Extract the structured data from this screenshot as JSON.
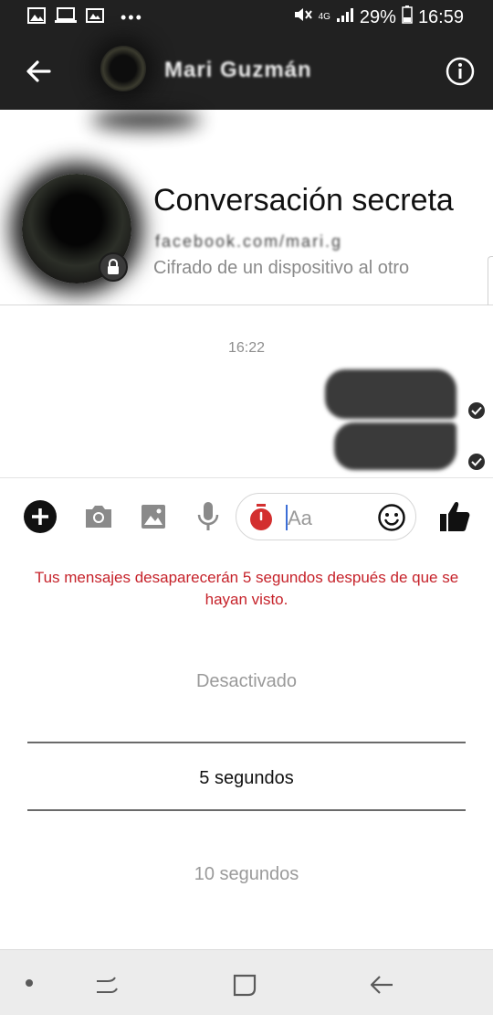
{
  "status_bar": {
    "battery": "29%",
    "time": "16:59",
    "network": "4G",
    "more_dots": "•••"
  },
  "app_bar": {
    "contact_name": "Mari Guzmán"
  },
  "header": {
    "title": "Conversación secreta",
    "handle": "facebook.com/mari.g",
    "subtitle": "Cifrado de un dispositivo al otro"
  },
  "messages": {
    "timestamp": "16:22"
  },
  "composer": {
    "placeholder": "Aa"
  },
  "disappear": {
    "notice": "Tus mensajes desaparecerán 5 segundos después de que se hayan visto.",
    "options": [
      "Desactivado",
      "5 segundos",
      "10 segundos"
    ],
    "selected": "5 segundos"
  },
  "colors": {
    "bar_bg": "#212121",
    "notice_red": "#c6222a",
    "timer_red": "#d32f2f",
    "cursor_blue": "#3b6ed6"
  },
  "icons": [
    "back-arrow-icon",
    "info-icon",
    "lock-icon",
    "add-icon",
    "camera-icon",
    "image-icon",
    "mic-icon",
    "timer-icon",
    "emoji-icon",
    "thumbs-up-icon",
    "recents-icon",
    "home-icon",
    "back-nav-icon"
  ]
}
